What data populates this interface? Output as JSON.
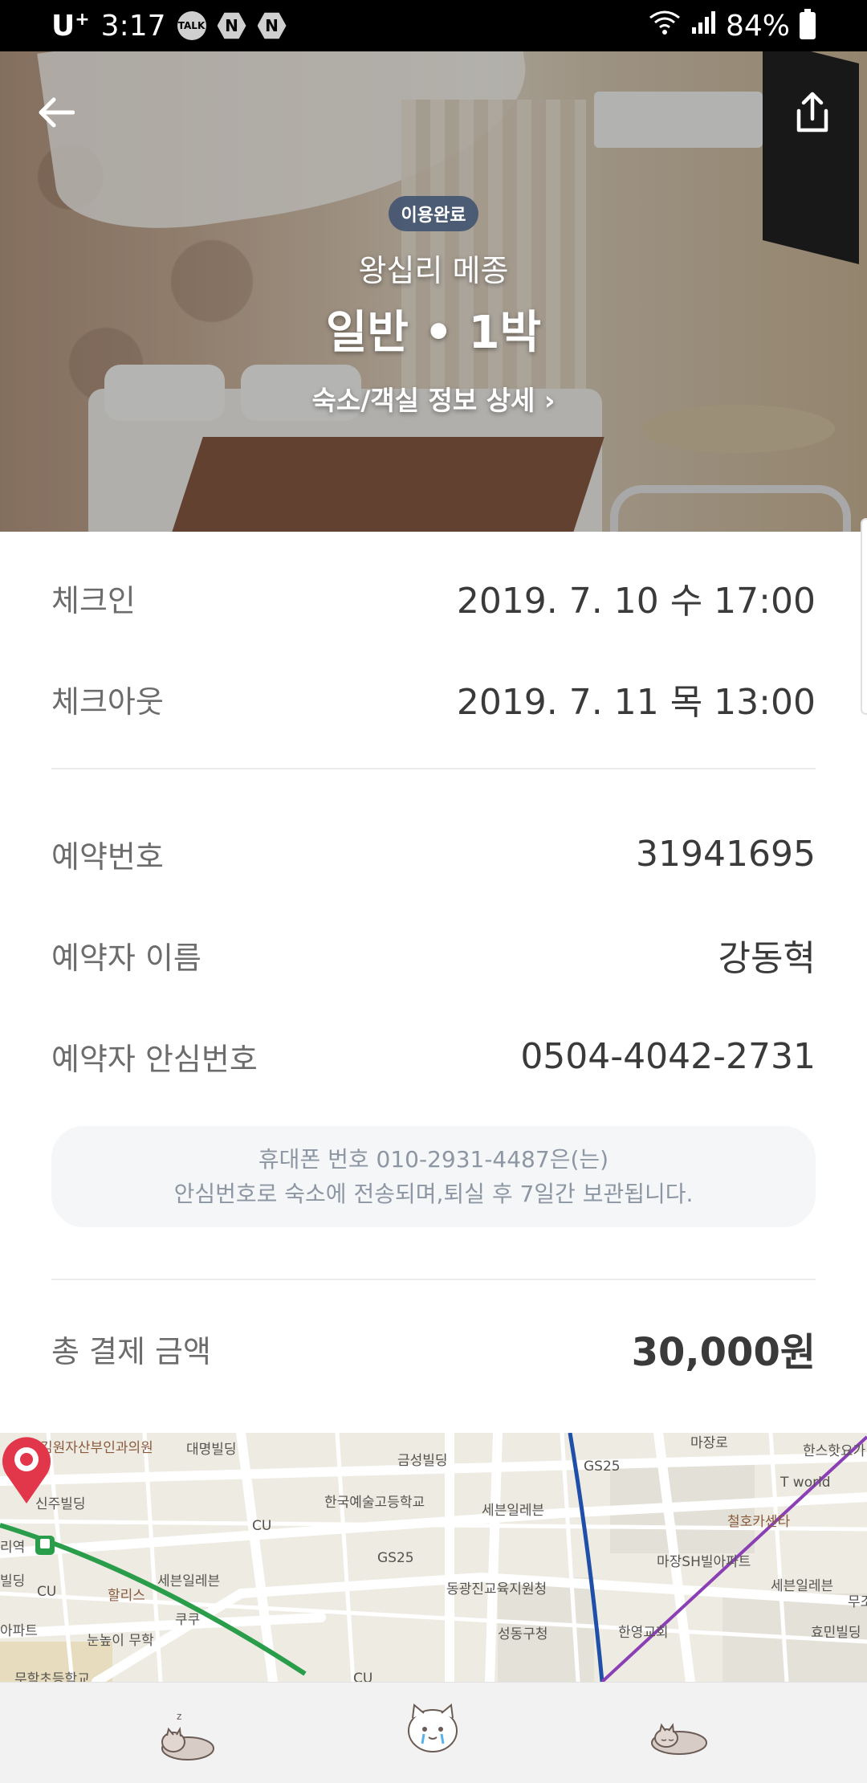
{
  "status_bar": {
    "carrier": "U",
    "carrier_sup": "+",
    "time": "3:17",
    "notifications": [
      "TALK",
      "N",
      "N"
    ],
    "battery": "84%"
  },
  "hero": {
    "badge": "이용완료",
    "hotel_name": "왕십리 메종",
    "room_info": "일반 • 1박",
    "detail_link": "숙소/객실 정보 상세 ›"
  },
  "reservation": {
    "checkin_label": "체크인",
    "checkin_value": "2019. 7. 10 수 17:00",
    "checkout_label": "체크아웃",
    "checkout_value": "2019. 7. 11 목 13:00",
    "number_label": "예약번호",
    "number_value": "31941695",
    "name_label": "예약자 이름",
    "name_value": "강동혁",
    "safe_number_label": "예약자 안심번호",
    "safe_number_value": "0504-4042-2731",
    "notice_line1": "휴대폰 번호 010-2931-4487은(는)",
    "notice_line2": "안심번호로 숙소에 전송되며,퇴실 후 7일간 보관됩니다.",
    "total_label": "총 결제 금액",
    "total_value": "30,000원"
  },
  "map": {
    "labels": [
      "김원자산부인과의원",
      "대명빌딩",
      "금성빌딩",
      "GS25",
      "한스핫요가",
      "신주빌딩",
      "한국예술고등학교",
      "세븐일레븐",
      "T world",
      "CU",
      "리역",
      "철호카센타",
      "GS25",
      "마장SH빌아파트",
      "빌딩",
      "CU",
      "할리스",
      "세븐일레븐",
      "동광진교육지원청",
      "세븐일레븐",
      "아파트",
      "쿠쿠",
      "성동구청",
      "한영교회",
      "눈높이 무학",
      "효민빌딩",
      "무학초등학교",
      "CU",
      "마장로",
      "무조"
    ]
  },
  "icons": {
    "back": "arrow-left-icon",
    "share": "share-icon",
    "nav_left": "sleeping-cat-icon",
    "nav_center": "crying-cat-icon",
    "nav_right": "lying-cat-icon"
  },
  "colors": {
    "badge_bg": "#3c506e",
    "pin": "#e2364a",
    "subway_green": "#2a9d4b",
    "subway_blue": "#1f4fa8",
    "subway_purple": "#8a3fb4"
  }
}
